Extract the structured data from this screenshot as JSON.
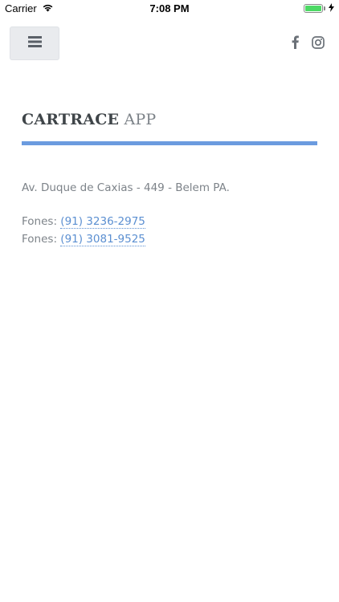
{
  "status_bar": {
    "carrier": "Carrier",
    "time": "7:08 PM"
  },
  "header": {
    "menu_icon": "hamburger-menu-icon",
    "social": [
      {
        "icon": "facebook-icon"
      },
      {
        "icon": "instagram-icon"
      }
    ]
  },
  "brand": {
    "strong": "CARTRACE",
    "light": "APP",
    "accent_color": "#6b9bdf"
  },
  "contact": {
    "address": "Av. Duque de Caxias - 449 - Belem PA.",
    "phones": [
      {
        "label": "Fones:",
        "number": "(91) 3236-2975"
      },
      {
        "label": "Fones:",
        "number": "(91) 3081-9525"
      }
    ],
    "link_color": "#5b8fd1"
  }
}
